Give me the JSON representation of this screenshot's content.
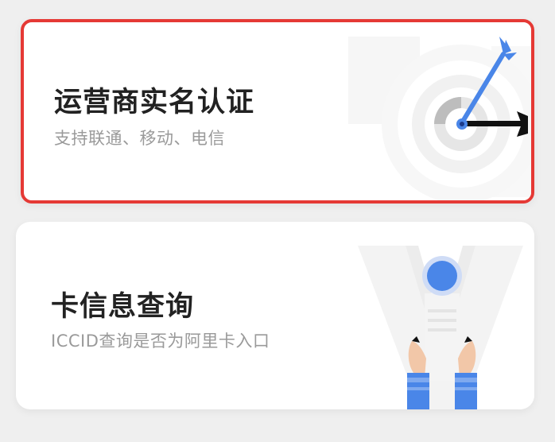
{
  "cards": [
    {
      "title": "运营商实名认证",
      "subtitle": "支持联通、移动、电信",
      "icon": "target-arrow-icon",
      "selected": true
    },
    {
      "title": "卡信息查询",
      "subtitle": "ICCID查询是否为阿里卡入口",
      "icon": "hands-holding-card-icon",
      "selected": false
    }
  ],
  "colors": {
    "background": "#efefef",
    "card": "#ffffff",
    "highlight_border": "#e53935",
    "accent_blue": "#4a86e8"
  }
}
